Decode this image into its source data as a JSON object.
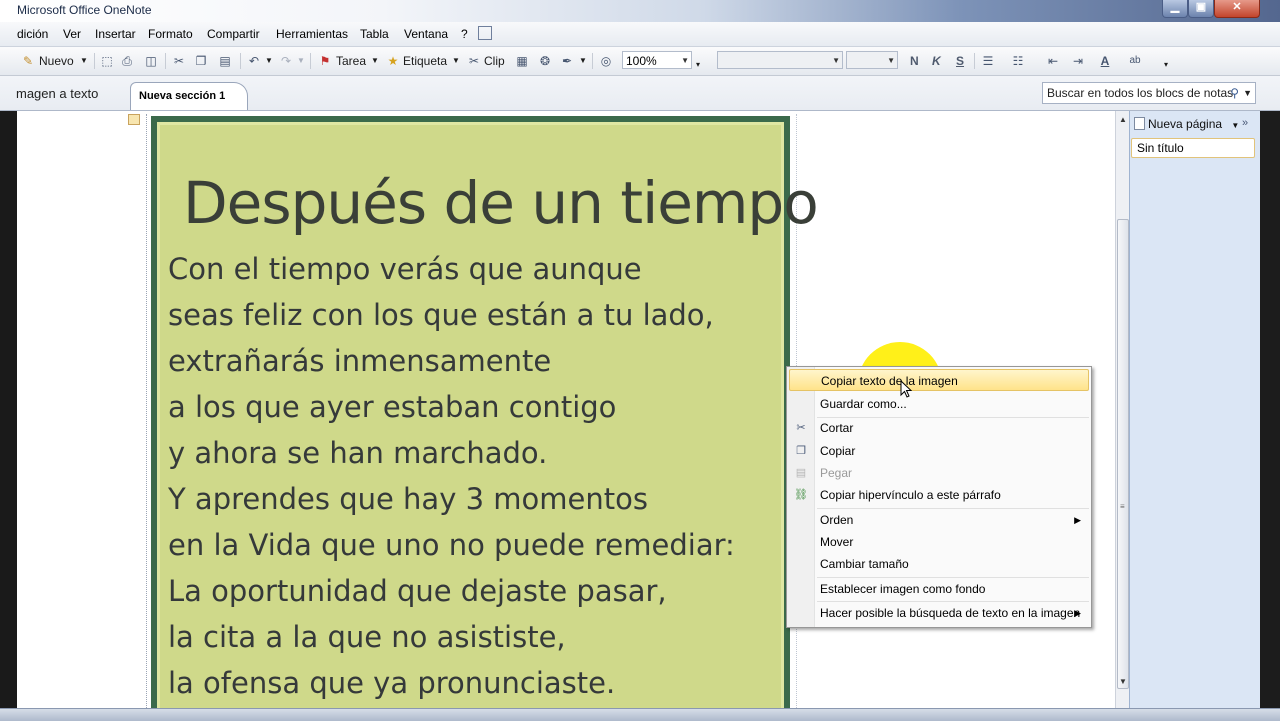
{
  "window": {
    "title": "Microsoft Office OneNote",
    "min_glyph": "▁",
    "max_glyph": "▣",
    "close_glyph": "✕"
  },
  "menu": [
    "dición",
    "Ver",
    "Insertar",
    "Formato",
    "Compartir",
    "Herramientas",
    "Tabla",
    "Ventana",
    "?"
  ],
  "toolbar": {
    "new_label": "Nuevo",
    "task_label": "Tarea",
    "tag_label": "Etiqueta",
    "clip_label": "Clip",
    "zoom_value": "100%",
    "bold": "N",
    "italic": "K",
    "strike": "S"
  },
  "tabs": {
    "section_1": "magen a texto",
    "section_2": "Nueva sección 1"
  },
  "search": {
    "placeholder": "Buscar en todos los blocs de notas"
  },
  "poem": {
    "title": "Después de un tiempo",
    "lines": [
      "Con el tiempo verás que aunque",
      "seas feliz con los que están a tu lado,",
      "extrañarás inmensamente",
      "a los que ayer estaban contigo",
      "y ahora se han marchado.",
      "Y aprendes que hay 3 momentos",
      "en la Vida que uno no puede remediar:",
      "La oportunidad que dejaste pasar,",
      "la cita a la que no asististe,",
      "la ofensa que ya pronunciaste."
    ]
  },
  "page_pane": {
    "new_page_label": "Nueva página",
    "chevron": "»",
    "pages": [
      "Sin título"
    ]
  },
  "context_menu": {
    "items": [
      {
        "label": "Copiar texto de la imagen",
        "icon": "",
        "highlighted": true
      },
      {
        "label": "Guardar como...",
        "icon": ""
      },
      {
        "label": "Cortar",
        "icon": "scissors-icon"
      },
      {
        "label": "Copiar",
        "icon": "copy-icon"
      },
      {
        "label": "Pegar",
        "icon": "paste-icon",
        "disabled": true
      },
      {
        "label": "Copiar hipervínculo a este párrafo",
        "icon": "hyperlink-icon"
      },
      {
        "label": "Orden",
        "icon": "",
        "submenu": true
      },
      {
        "label": "Mover",
        "icon": ""
      },
      {
        "label": "Cambiar tamaño",
        "icon": ""
      },
      {
        "label": "Establecer imagen como fondo",
        "icon": ""
      },
      {
        "label": "Hacer posible la búsqueda de texto en la imagen",
        "icon": "",
        "submenu": true
      }
    ]
  },
  "colors": {
    "card_bg": "#cfd98a",
    "card_border": "#3b6a4b",
    "highlight": "#ffee00"
  }
}
